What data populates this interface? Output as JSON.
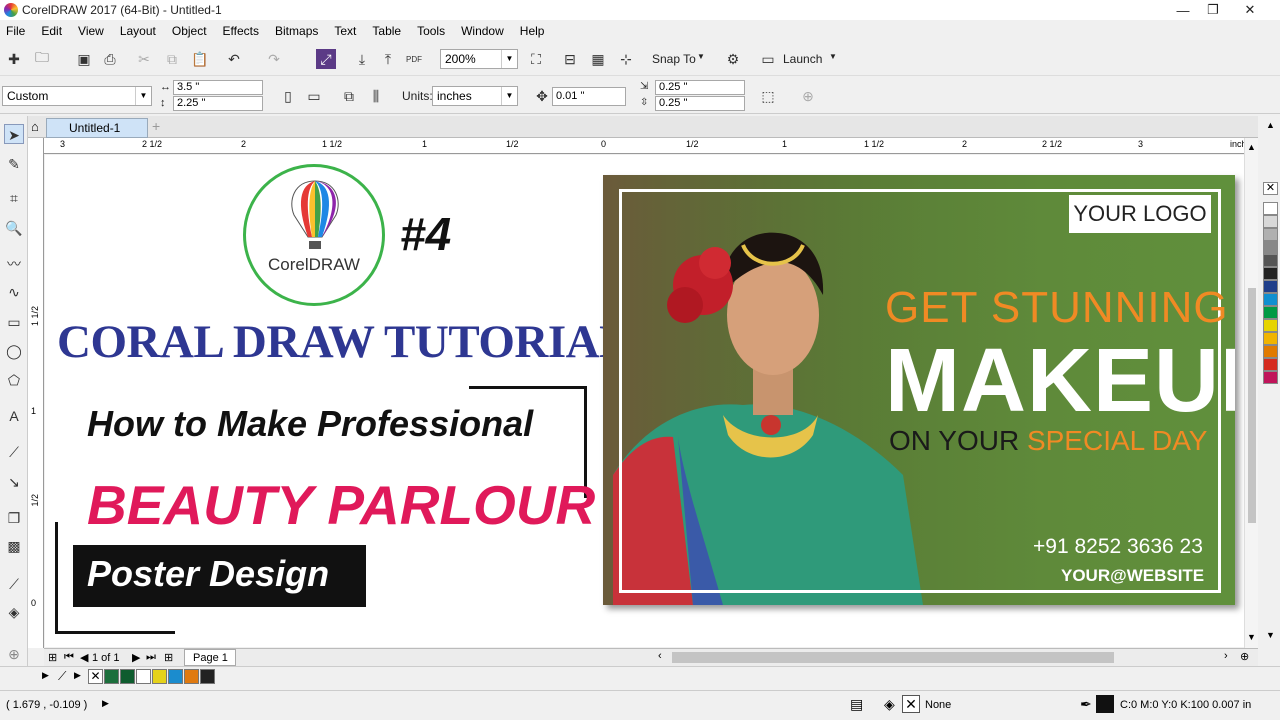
{
  "titlebar": {
    "title": "CorelDRAW 2017 (64-Bit) - Untitled-1",
    "minimize": "—",
    "restore": "❐",
    "close": "✕"
  },
  "menu": [
    "File",
    "Edit",
    "View",
    "Layout",
    "Object",
    "Effects",
    "Bitmaps",
    "Text",
    "Table",
    "Tools",
    "Window",
    "Help"
  ],
  "toolbar": {
    "zoom": "200%",
    "snap_to": "Snap To",
    "launch": "Launch"
  },
  "propbar": {
    "preset": "Custom",
    "width": "3.5 \"",
    "height": "2.25 \"",
    "units_label": "Units:",
    "units": "inches",
    "nudge": "0.01 \"",
    "dup_x": "0.25 \"",
    "dup_y": "0.25 \""
  },
  "doc_tab": "Untitled-1",
  "ruler": {
    "h_ticks": [
      "3",
      "2 1/2",
      "2",
      "1 1/2",
      "1",
      "1/2",
      "0",
      "1/2",
      "1",
      "1 1/2",
      "2",
      "2 1/2",
      "3"
    ],
    "h_units": "inches",
    "v_ticks": [
      "1 1/2",
      "1",
      "1/2",
      "0"
    ]
  },
  "thumb": {
    "hash": "#4",
    "logo_text": "CorelDRAW",
    "title": "CORAL DRAW TUTORIAL",
    "line1": "How to Make Professional",
    "line2": "BEAUTY PARLOUR",
    "line3": "Poster Design"
  },
  "poster": {
    "logo": "YOUR LOGO",
    "line1": "GET STUNNING",
    "line2": "MAKEUP",
    "line3a": "ON YOUR ",
    "line3b": "SPECIAL DAY",
    "phone": "+91 8252 3636 23",
    "website": "YOUR@WEBSITE",
    "colors": {
      "bg": "#5a7d36",
      "accent": "#f08a24"
    }
  },
  "pagebar": {
    "page_count": "1 of 1",
    "page_tab": "Page 1"
  },
  "status": {
    "coords": "( 1.679 , -0.109 )",
    "fill": "None",
    "outline": "C:0 M:0 Y:0 K:100  0.007 in"
  },
  "palette_colors": [
    "#ffffff",
    "#d8d8d8",
    "#b0b0b0",
    "#888888",
    "#555555",
    "#222222",
    "#1f3e8a",
    "#0f8fd0",
    "#009a44",
    "#e6d400",
    "#f0b400",
    "#e07a00",
    "#d52b1e",
    "#c0145a"
  ],
  "doc_palette": [
    "#1c6f3c",
    "#0e5c2e",
    "#ffffff",
    "#e5d21a",
    "#1b8cce",
    "#e07a10",
    "#222222"
  ]
}
